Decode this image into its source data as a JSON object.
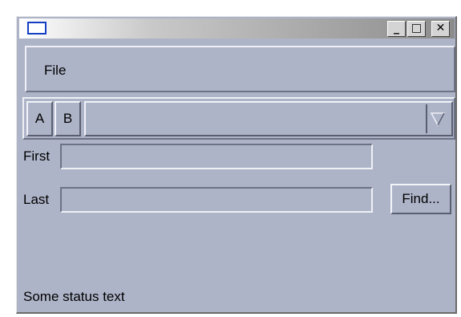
{
  "window": {
    "title": "",
    "buttons": {
      "minimize": "_",
      "maximize": "□",
      "close": "✕"
    },
    "app_icon": "window-icon",
    "titlebar_gradient": [
      "#ffffff",
      "#c9c9c9",
      "#8c8c8c"
    ],
    "background": "#aeb4c8"
  },
  "menubar": {
    "items": [
      {
        "label": "File"
      }
    ]
  },
  "toolbar": {
    "buttons": [
      {
        "label": "A"
      },
      {
        "label": "B"
      }
    ],
    "combo": {
      "value": "",
      "arrow_icon": "triangle-down-icon"
    }
  },
  "form": {
    "first_label": "First",
    "first_value": "",
    "last_label": "Last",
    "last_value": "",
    "find_label": "Find..."
  },
  "status": {
    "text": "Some status text"
  }
}
